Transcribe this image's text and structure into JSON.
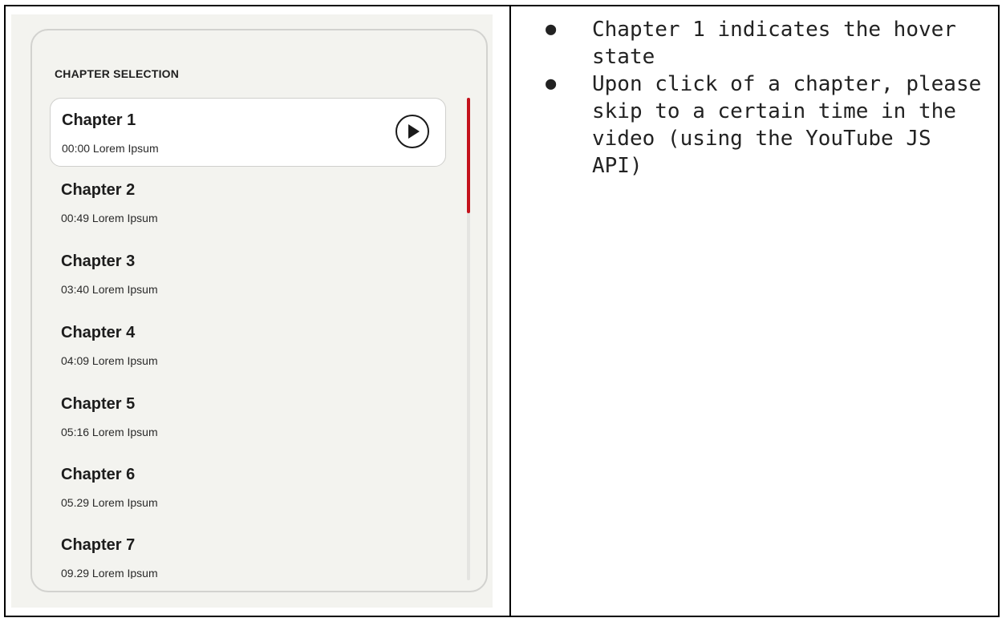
{
  "panel": {
    "title": "CHAPTER SELECTION",
    "chapters": [
      {
        "name": "Chapter 1",
        "meta": "00:00 Lorem Ipsum"
      },
      {
        "name": "Chapter 2",
        "meta": "00:49 Lorem Ipsum"
      },
      {
        "name": "Chapter 3",
        "meta": "03:40 Lorem Ipsum"
      },
      {
        "name": "Chapter 4",
        "meta": "04:09 Lorem Ipsum"
      },
      {
        "name": "Chapter 5",
        "meta": "05:16 Lorem Ipsum"
      },
      {
        "name": "Chapter 6",
        "meta": "05.29 Lorem Ipsum"
      },
      {
        "name": "Chapter 7",
        "meta": "09.29 Lorem Ipsum"
      }
    ],
    "play_icon": "play-icon",
    "accent_color": "#c4121c"
  },
  "notes": {
    "bullet": "●",
    "items": [
      "Chapter 1 indicates the hover state",
      "Upon click of a chapter, please skip to a certain time in the video (using the YouTube JS API)"
    ]
  }
}
